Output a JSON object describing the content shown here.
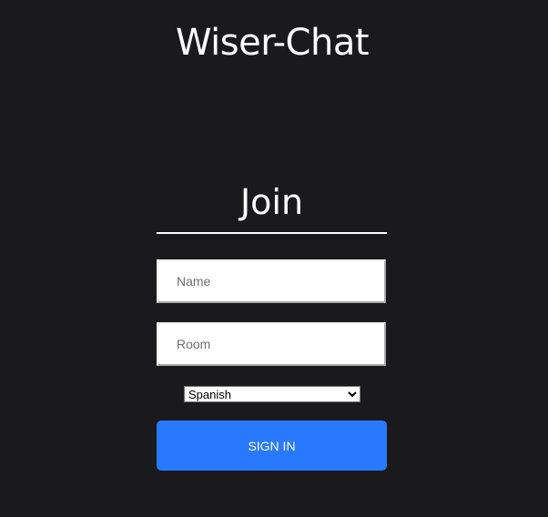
{
  "app": {
    "title": "Wiser-Chat"
  },
  "join": {
    "heading": "Join",
    "name_placeholder": "Name",
    "name_value": "",
    "room_placeholder": "Room",
    "room_value": "",
    "language_selected": "Spanish",
    "signin_label": "SIGN IN"
  },
  "colors": {
    "background": "#1a1a1d",
    "accent": "#2979ff",
    "text": "#ffffff"
  }
}
